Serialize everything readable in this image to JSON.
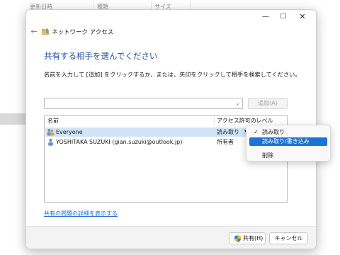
{
  "background": {
    "columns": [
      "更新日時",
      "種類",
      "サイズ"
    ]
  },
  "dialog": {
    "title": "ネットワーク アクセス",
    "window_controls": {
      "minimize": "—",
      "maximize": "☐",
      "close": "✕"
    },
    "back_icon": "←",
    "heading": "共有する相手を選んでください",
    "instruction": "名前を入力して [追加] をクリックするか、または、矢印をクリックして相手を検索してください。",
    "name_input": {
      "value": "",
      "arrow": "⌄"
    },
    "add_button": "追加(A)",
    "list": {
      "headers": {
        "name": "名前",
        "permission": "アクセス許可のレベル"
      },
      "rows": [
        {
          "name": "Everyone",
          "permission": "読み取り",
          "arrow": "▼"
        },
        {
          "name": "YOSHITAKA SUZUKI (gian.suzuki@outlook.jp)",
          "permission": "所有者"
        }
      ]
    },
    "help_link": "共有の問題の詳細を表示する",
    "share_button": "共有(H)",
    "cancel_button": "キャンセル"
  },
  "context_menu": {
    "items": [
      {
        "label": "読み取り",
        "checked": true,
        "check": "✓"
      },
      {
        "label": "読み取り/書き込み",
        "highlighted": true
      },
      {
        "label": "削除"
      }
    ]
  },
  "colors": {
    "accent": "#1c72d6",
    "heading": "#1f4e9c",
    "selected_row": "#cfe4f7",
    "link": "#1f6bd6"
  }
}
